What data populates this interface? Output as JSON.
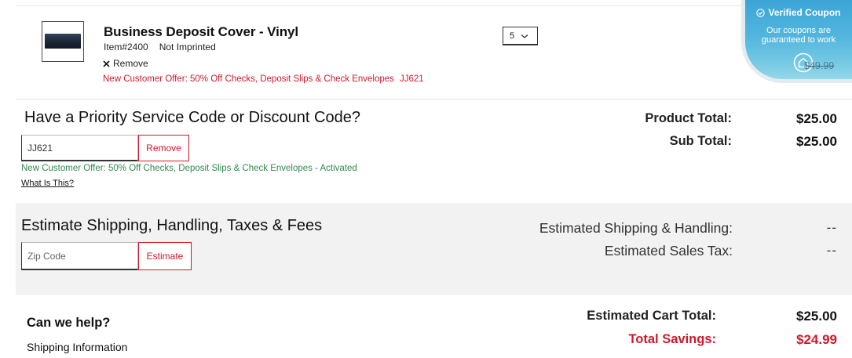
{
  "cart_item": {
    "name": "Business Deposit Cover - Vinyl",
    "item_number": "Item#2400",
    "imprint": "Not Imprinted",
    "remove_icon": "close-icon",
    "remove_label": "Remove",
    "offer_text": "New Customer Offer: 50% Off Checks, Deposit Slips & Check Envelopes",
    "offer_code": "JJ621",
    "quantity": "5",
    "original_price": "$49.99"
  },
  "coupon_badge": {
    "check_icon": "check-circle-icon",
    "title": "Verified Coupon",
    "message_line1": "Our coupons are",
    "message_line2": "guaranteed to work",
    "badge_icon": "shield-home-icon"
  },
  "discount": {
    "title": "Have a Priority Service Code or Discount Code?",
    "code_value": "JJ621",
    "remove_button": "Remove",
    "status": "New Customer Offer: 50% Off Checks, Deposit Slips & Check Envelopes - Activated",
    "help_link": "What Is This?"
  },
  "totals": {
    "product_total_label": "Product Total:",
    "product_total_value": "$25.00",
    "sub_total_label": "Sub Total:",
    "sub_total_value": "$25.00"
  },
  "shipping": {
    "title": "Estimate Shipping, Handling, Taxes & Fees",
    "zip_placeholder": "Zip Code",
    "estimate_button": "Estimate",
    "shipping_label": "Estimated Shipping & Handling:",
    "shipping_value": "--",
    "tax_label": "Estimated Sales Tax:",
    "tax_value": "--"
  },
  "help": {
    "title": "Can we help?",
    "links": [
      "Shipping Information"
    ]
  },
  "summary": {
    "cart_total_label": "Estimated Cart Total:",
    "cart_total_value": "$25.00",
    "savings_label": "Total Savings:",
    "savings_value": "$24.99"
  },
  "colors": {
    "accent_red": "#d0192b",
    "success_green": "#2e8b4f",
    "badge_blue": "#2e9fd4",
    "section_gray": "#f2f2f2"
  }
}
